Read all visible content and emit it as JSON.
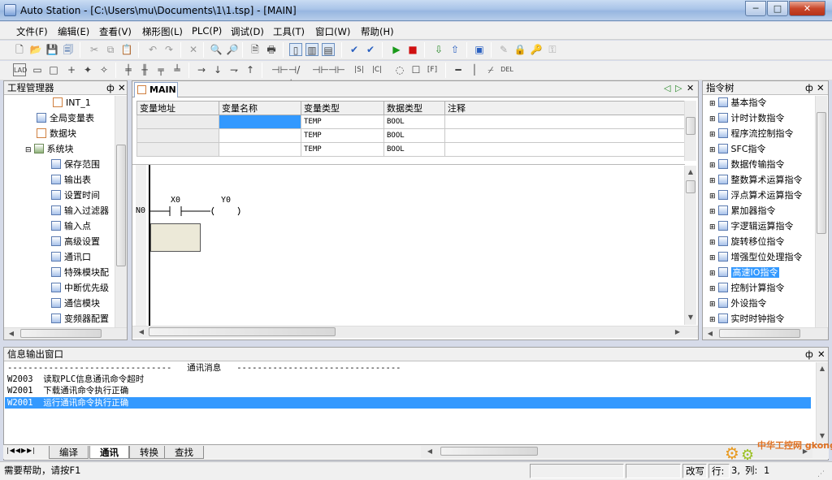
{
  "window": {
    "title": "Auto Station - [C:\\Users\\mu\\Documents\\1\\1.tsp] - [MAIN]",
    "minimize": "─",
    "maximize": "□",
    "close": "✕"
  },
  "menu": [
    "文件(F)",
    "编辑(E)",
    "查看(V)",
    "梯形图(L)",
    "PLC(P)",
    "调试(D)",
    "工具(T)",
    "窗口(W)",
    "帮助(H)"
  ],
  "project_panel": {
    "title": "工程管理器",
    "pin": "ф",
    "close": "✕",
    "items": [
      "INT_1",
      "全局变量表",
      "数据块",
      "系统块",
      "保存范围",
      "输出表",
      "设置时间",
      "输入过滤器",
      "输入点",
      "高级设置",
      "通讯口",
      "特殊模块配",
      "中断优先级",
      "通信模块",
      "变频器配置"
    ]
  },
  "editor": {
    "tab": "MAIN",
    "nav": [
      "◁",
      "▷",
      "✕"
    ],
    "columns": [
      "变量地址",
      "变量名称",
      "变量类型",
      "数据类型",
      "注释"
    ],
    "rows": [
      [
        "",
        "",
        "TEMP",
        "BOOL",
        ""
      ],
      [
        "",
        "",
        "TEMP",
        "BOOL",
        ""
      ],
      [
        "",
        "",
        "TEMP",
        "BOOL",
        ""
      ]
    ],
    "ladder": {
      "network": "N0",
      "contact": "X0",
      "coil": "Y0"
    }
  },
  "instr_panel": {
    "title": "指令树",
    "items": [
      "基本指令",
      "计时计数指令",
      "程序流控制指令",
      "SFC指令",
      "数据传输指令",
      "整数算术运算指令",
      "浮点算术运算指令",
      "累加器指令",
      "字逻辑运算指令",
      "旋转移位指令",
      "增强型位处理指令",
      "高速IO指令",
      "控制计算指令",
      "外设指令",
      "实时时钟指令"
    ],
    "selected": "高速IO指令"
  },
  "info_panel": {
    "title": "信息输出窗口",
    "header": "--------------------------------   通讯消息   --------------------------------",
    "lines": [
      "W2003  读取PLC信息通讯命令超时",
      "W2001  下载通讯命令执行正确",
      "W2001  运行通讯命令执行正确"
    ],
    "tabs": [
      "编译",
      "通讯",
      "转换",
      "查找"
    ]
  },
  "status": {
    "help": "需要帮助，请按F1",
    "mode": "改写",
    "row_label": "行:",
    "row": "3,",
    "col_label": "列:",
    "col": "1"
  },
  "watermark": "中华工控网 gkong.com"
}
